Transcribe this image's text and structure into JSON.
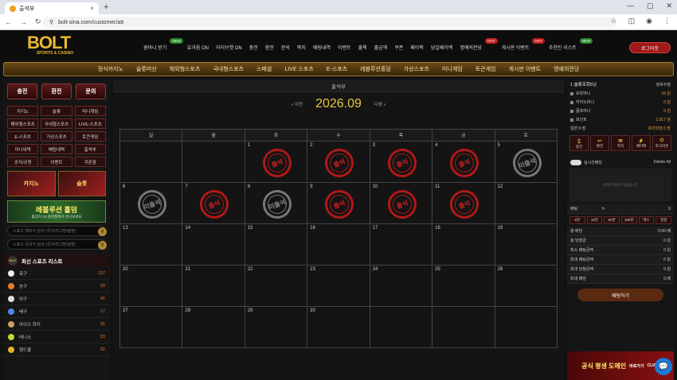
{
  "browser": {
    "tab_title": "출석부",
    "url": "bolt-sina.com/customer/att"
  },
  "logo": {
    "name": "BOLT",
    "sub": "SPORTS & CASINO"
  },
  "topnav": [
    {
      "label": "콤마니 받기",
      "badge": "NEW"
    },
    {
      "label": "효과음 ON"
    },
    {
      "label": "라이브챗 ON"
    },
    {
      "label": "충전"
    },
    {
      "label": "환전"
    },
    {
      "label": "문의"
    },
    {
      "label": "쪽지"
    },
    {
      "label": "배팅내역"
    },
    {
      "label": "이벤트"
    },
    {
      "label": "출첵"
    },
    {
      "label": "출금액"
    },
    {
      "label": "쿠폰"
    },
    {
      "label": "페이백"
    },
    {
      "label": "당일페이백"
    },
    {
      "label": "명예의전당",
      "badge": "HOT"
    },
    {
      "label": "게시판 이벤트",
      "badge": "HOT"
    },
    {
      "label": "추천인 리스트",
      "badge": "NEW"
    }
  ],
  "logout_label": "로그아웃",
  "mainnav": [
    "정식카지노",
    "슬롯머신",
    "해외형스포츠",
    "국내형스포츠",
    "스페셜",
    "LIVE 스포츠",
    "E-스포츠",
    "레볼루션홀덤",
    "가상스포츠",
    "미니게임",
    "토큰게임",
    "게시판 이벤트",
    "명예의전당"
  ],
  "left": {
    "actions": [
      "충전",
      "환전",
      "문의"
    ],
    "menu": [
      "카지노",
      "슬롯",
      "미니게임",
      "해외형스포츠",
      "국내형스포츠",
      "LIVE-스포츠",
      "E-스포츠",
      "가상스포츠",
      "토큰게임",
      "미니내역",
      "배팅내역",
      "출석부",
      "공지/규정",
      "이벤트",
      "쿠폰함"
    ],
    "banners": [
      "카지노",
      "슬롯"
    ],
    "banner2": {
      "title": "레볼루션 홀덤",
      "sub": "홀덤이 V3 플랫폼에서 만나보세요"
    },
    "search1": "스포츠 해외식 검색 (국가/리그명/팀명)",
    "search2": "스포츠 국내식 검색 (국가/리그명/팀명)",
    "sports_title": "최신 스포츠 리스트",
    "sports": [
      {
        "name": "축구",
        "count": "137",
        "color": "#eee"
      },
      {
        "name": "농구",
        "count": "20",
        "color": "#e87a30"
      },
      {
        "name": "야구",
        "count": "41",
        "color": "#ddd"
      },
      {
        "name": "배구",
        "count": "17",
        "color": "#4a8ae8"
      },
      {
        "name": "아이스 하키",
        "count": "31",
        "color": "#c8a060"
      },
      {
        "name": "테니스",
        "count": "33",
        "color": "#c8d830"
      },
      {
        "name": "핸드볼",
        "count": "32",
        "color": "#e8b030"
      }
    ]
  },
  "center": {
    "title": "출석부",
    "prev": "« 이전",
    "month": "2026.09",
    "next": "다음 »",
    "days": [
      "일",
      "월",
      "화",
      "수",
      "목",
      "금",
      "토"
    ],
    "stamp_att": "출석",
    "stamp_abs": "미출석",
    "weeks": [
      [
        {
          "d": ""
        },
        {
          "d": ""
        },
        {
          "d": "1",
          "s": "att"
        },
        {
          "d": "2",
          "s": "att"
        },
        {
          "d": "3",
          "s": "att"
        },
        {
          "d": "4",
          "s": "att"
        },
        {
          "d": "5",
          "s": "abs"
        }
      ],
      [
        {
          "d": "6",
          "s": "abs"
        },
        {
          "d": "7",
          "s": "att"
        },
        {
          "d": "8",
          "s": "abs"
        },
        {
          "d": "9",
          "s": "att"
        },
        {
          "d": "10",
          "s": "att"
        },
        {
          "d": "11",
          "s": "att"
        },
        {
          "d": "12"
        }
      ],
      [
        {
          "d": "13"
        },
        {
          "d": "14"
        },
        {
          "d": "15"
        },
        {
          "d": "16"
        },
        {
          "d": "17"
        },
        {
          "d": "18"
        },
        {
          "d": "19"
        }
      ],
      [
        {
          "d": "20"
        },
        {
          "d": "21"
        },
        {
          "d": "22"
        },
        {
          "d": "23"
        },
        {
          "d": "24"
        },
        {
          "d": "25"
        },
        {
          "d": "26"
        }
      ],
      [
        {
          "d": "27"
        },
        {
          "d": "28"
        },
        {
          "d": "29"
        },
        {
          "d": "30"
        },
        {
          "d": ""
        },
        {
          "d": ""
        },
        {
          "d": ""
        }
      ]
    ]
  },
  "right": {
    "user": "1 슬롯조회5닝",
    "info": "정보수정",
    "rows": [
      {
        "k": "보유머니",
        "v": "15 원"
      },
      {
        "k": "카지노머니",
        "v": "0 원"
      },
      {
        "k": "콤프머니",
        "v": "0 원"
      },
      {
        "k": "포인트",
        "v": "1,017 원"
      }
    ],
    "betinfo": [
      "일반 0 장",
      "프리미엄 0 장"
    ],
    "buttons": [
      "충전",
      "환전",
      "쪽지",
      "페이백",
      "로그아웃"
    ],
    "live_label": "실시간배당",
    "delete_all": "Delete All",
    "slip_empty": "선택된 배당이 없습니다.",
    "bet_label": "배팅",
    "bet_value": "0",
    "chips": [
      "5만",
      "10만",
      "50만",
      "100만",
      "맥스",
      "정정"
    ],
    "stats": [
      {
        "k": "총 배당",
        "v": "0.00 배"
      },
      {
        "k": "총 당첨금",
        "v": "0 원"
      },
      {
        "k": "최소 배팅금액",
        "v": "0 원"
      },
      {
        "k": "최대 배팅금액",
        "v": "0 원"
      },
      {
        "k": "최대 당첨금액",
        "v": "0 원"
      },
      {
        "k": "최대 배당",
        "v": "0 배"
      }
    ],
    "bet_button": "배팅하기",
    "promo": "공식 평생 도메인",
    "promo_sub": "바로가기",
    "click": "CLICK"
  }
}
